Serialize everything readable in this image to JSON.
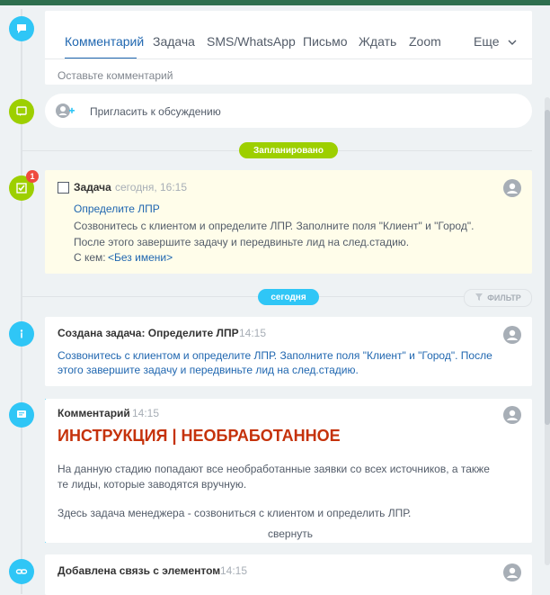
{
  "composer": {
    "tabs": [
      {
        "label": "Комментарий"
      },
      {
        "label": "Задача"
      },
      {
        "label": "SMS/WhatsApp"
      },
      {
        "label": "Письмо"
      },
      {
        "label": "Ждать"
      },
      {
        "label": "Zoom"
      }
    ],
    "more_label": "Еще",
    "placeholder": "Оставьте комментарий"
  },
  "invite": {
    "label": "Пригласить к обсуждению"
  },
  "planned": {
    "label": "Запланировано"
  },
  "task": {
    "badge_count": "1",
    "title": "Задача",
    "time": "сегодня, 16:15",
    "name": "Определите ЛПР",
    "desc_line1": "Созвонитесь с клиентом и определите ЛПР. Заполните поля \"Клиент\" и \"Город\".",
    "desc_line2": "После этого завершите задачу и передвиньте лид на след.стадию.",
    "with_label": "С кем:",
    "with_value": "<Без имени>"
  },
  "today": {
    "label": "сегодня"
  },
  "filter": {
    "label": "ФИЛЬТР"
  },
  "events": [
    {
      "title": "Создана задача: Определите ЛПР",
      "time": "14:15",
      "line1": "Созвонитесь с клиентом и определите ЛПР. Заполните поля \"Клиент\" и \"Город\". После",
      "line2": "этого завершите задачу и передвиньте лид на след.стадию."
    },
    {
      "title": "Комментарий",
      "time": "14:15",
      "headline": "ИНСТРУКЦИЯ | НЕОБРАБОТАННОЕ",
      "p1_line1": "На данную стадию попадают все необработанные заявки со всех источников, а также",
      "p1_line2": "те лиды, которые заводятся вручную.",
      "p2": "Здесь задача менеджера - созвониться с клиентом и определить ЛПР.",
      "collapse": "свернуть"
    },
    {
      "title": "Добавлена связь с элементом",
      "time": "14:15"
    }
  ],
  "colors": {
    "accent_blue": "#2fc6f6",
    "accent_green": "#9dcf00",
    "link_blue": "#2067b0",
    "headline_red": "#c5320b",
    "badge_red": "#ef4b3f"
  }
}
